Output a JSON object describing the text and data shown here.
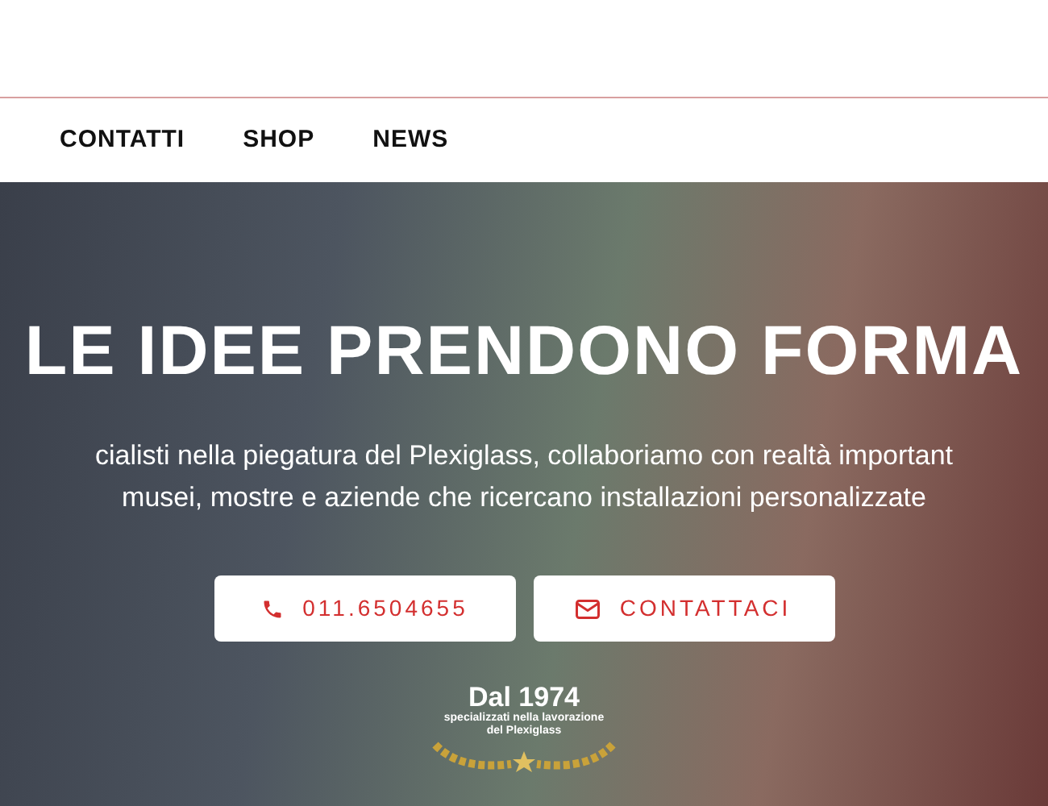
{
  "nav": {
    "items": [
      {
        "label": "CONTATTI"
      },
      {
        "label": "SHOP"
      },
      {
        "label": "NEWS"
      }
    ]
  },
  "hero": {
    "title": "LE IDEE PRENDONO FORMA",
    "subtitle_lines": [
      "cialisti nella piegatura del Plexiglass, collaboriamo con realtà important",
      "musei, mostre e aziende che ricercano installazioni personalizzate"
    ],
    "buttons": [
      {
        "kind": "phone",
        "label": "011.6504655"
      },
      {
        "kind": "mail",
        "label": "CONTATTACI"
      }
    ],
    "badge": {
      "year": "Dal 1974",
      "lines": [
        "specializzati nella lavorazione",
        "del Plexiglass"
      ]
    }
  }
}
